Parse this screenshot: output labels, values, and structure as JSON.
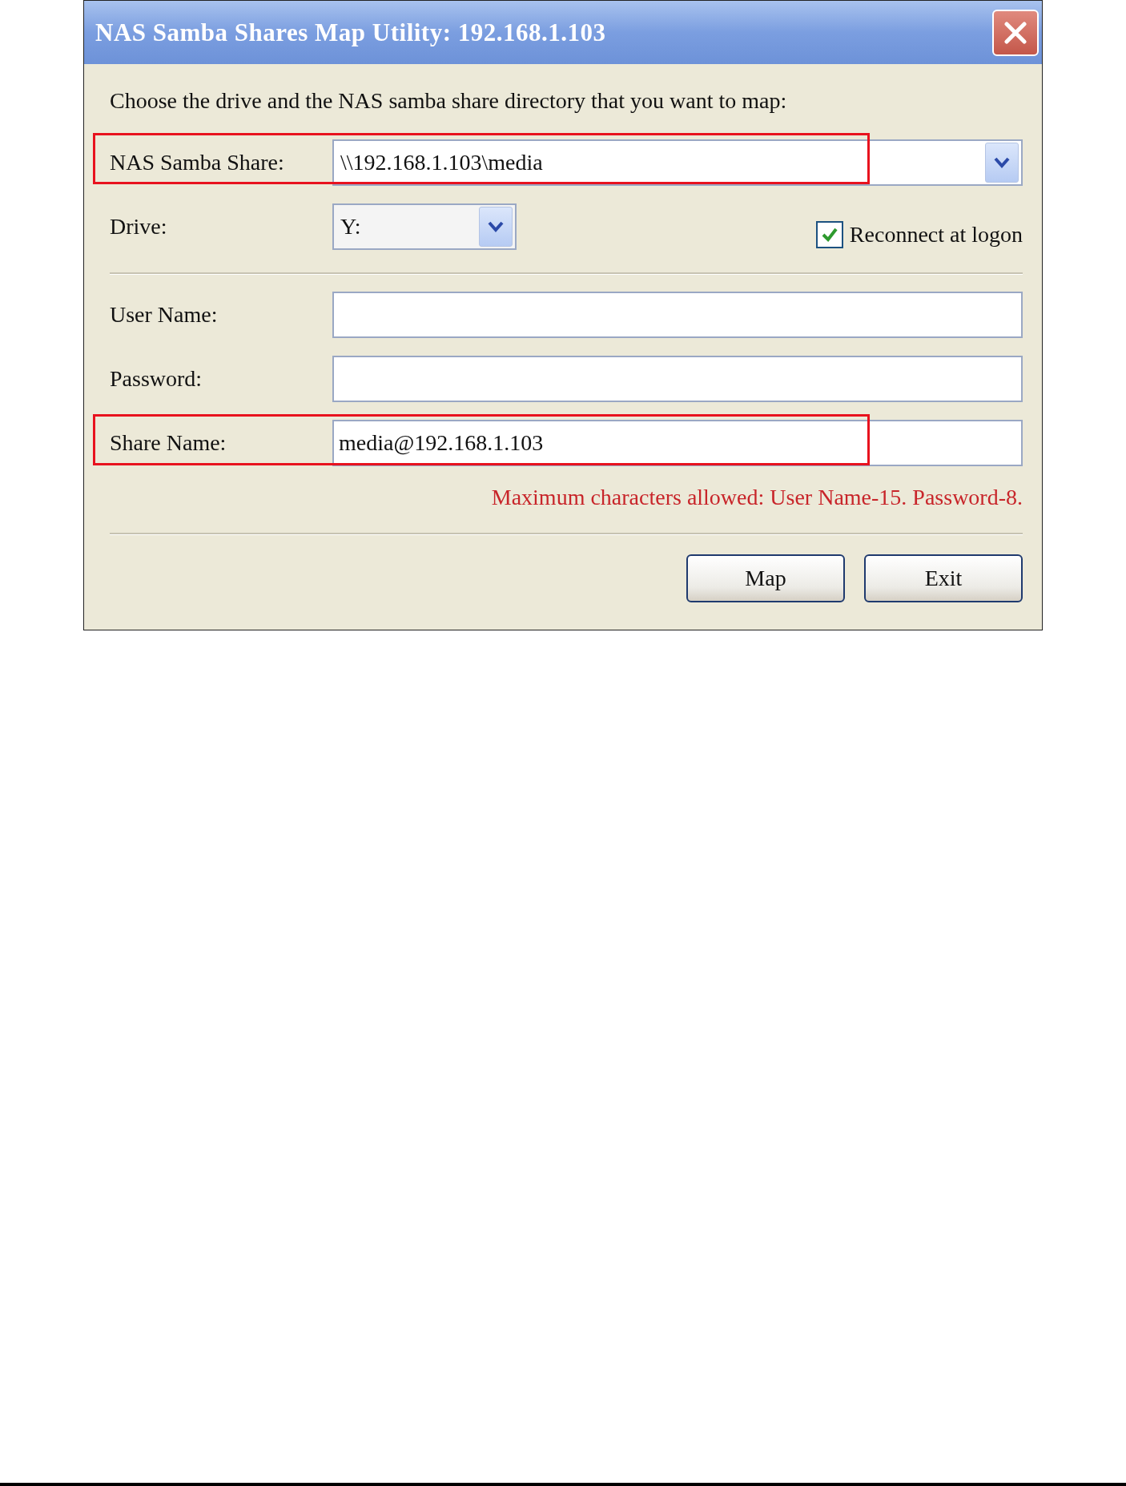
{
  "window": {
    "title": "NAS Samba Shares Map Utility: 192.168.1.103"
  },
  "instruction": "Choose the drive and the NAS samba share directory that you want to map:",
  "share": {
    "label": "NAS Samba Share:",
    "value": "\\\\192.168.1.103\\media",
    "highlighted": true
  },
  "drive": {
    "label": "Drive:",
    "value": "Y:"
  },
  "reconnect": {
    "label": "Reconnect at logon",
    "checked": true
  },
  "fields": [
    {
      "label": "User Name:",
      "highlighted": false
    },
    {
      "label": "Password:",
      "highlighted": false
    },
    {
      "label": "Share Name:",
      "value": "media@192.168.1.103",
      "highlighted": true
    }
  ],
  "note": "Maximum characters allowed: User Name-15. Password-8.",
  "buttons": [
    "Map",
    "Exit"
  ]
}
